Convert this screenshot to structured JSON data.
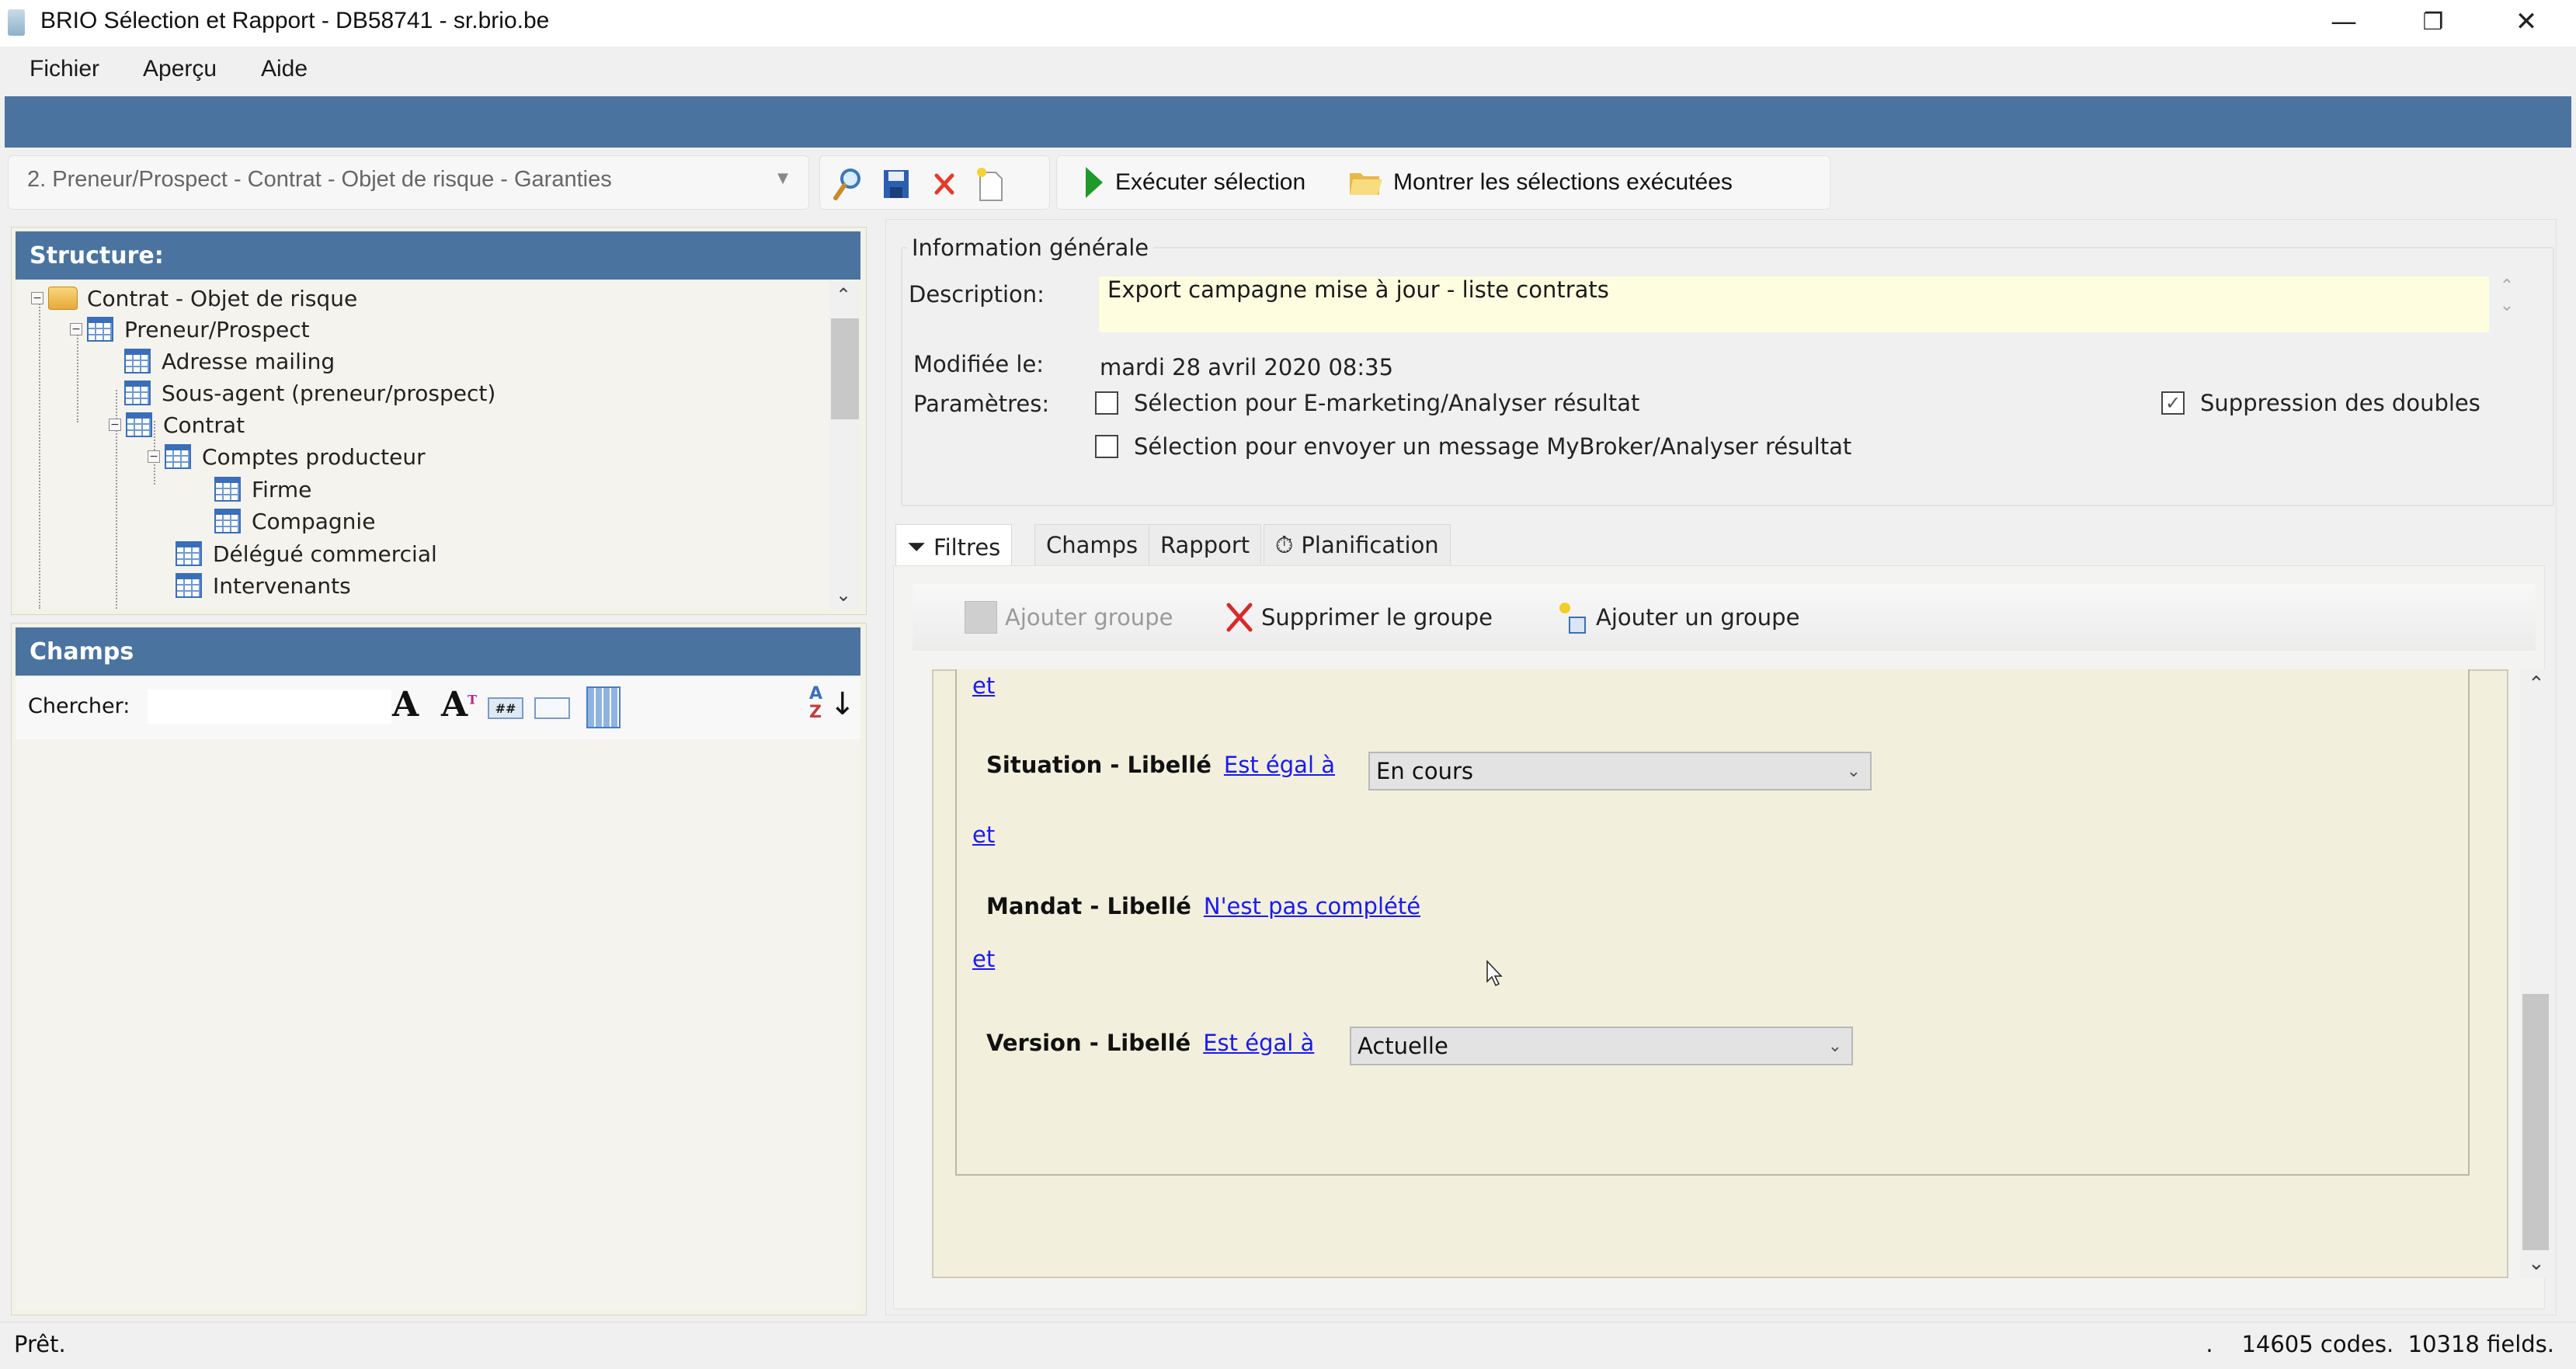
{
  "window": {
    "title": "BRIO Sélection et Rapport - DB58741 - sr.brio.be",
    "minimize": "—",
    "restore": "❐",
    "close": "✕"
  },
  "menu": [
    "Fichier",
    "Aperçu",
    "Aide"
  ],
  "toolbar": {
    "query_selected": "2. Preneur/Prospect - Contrat - Objet de risque - Garanties",
    "icons": [
      "search-icon",
      "save-icon",
      "delete-icon",
      "new-document-icon"
    ],
    "execute_label": "Exécuter sélection",
    "show_executed_label": "Montrer les sélections exécutées"
  },
  "structure": {
    "title": "Structure:",
    "tree": [
      {
        "label": "Contrat - Objet de risque",
        "level": 0,
        "icon": "folder",
        "expanded": true
      },
      {
        "label": "Preneur/Prospect",
        "level": 1,
        "icon": "table",
        "expanded": true
      },
      {
        "label": "Adresse mailing",
        "level": 2,
        "icon": "table"
      },
      {
        "label": "Sous-agent (preneur/prospect)",
        "level": 2,
        "icon": "table"
      },
      {
        "label": "Contrat",
        "level": 2,
        "icon": "table",
        "expanded": true
      },
      {
        "label": "Comptes producteur",
        "level": 3,
        "icon": "table",
        "expanded": true
      },
      {
        "label": "Firme",
        "level": 4,
        "icon": "table"
      },
      {
        "label": "Compagnie",
        "level": 4,
        "icon": "table"
      },
      {
        "label": "Délégué commercial",
        "level": 3,
        "icon": "table"
      },
      {
        "label": "Intervenants",
        "level": 3,
        "icon": "table"
      }
    ]
  },
  "champs": {
    "title": "Champs",
    "search_label": "Chercher:",
    "search_value": "",
    "tools": [
      "font-icon",
      "font-superscript-icon",
      "number-field-icon",
      "text-field-icon",
      "calculator-icon",
      "sort-az-icon"
    ]
  },
  "info": {
    "legend": "Information générale",
    "description_label": "Description:",
    "description": "Export campagne mise à jour - liste contrats",
    "modified_label": "Modifiée le:",
    "modified": "mardi 28 avril 2020 08:35",
    "params_label": "Paramètres:",
    "params": [
      {
        "label": "Sélection pour E-marketing/Analyser résultat",
        "checked": false
      },
      {
        "label": "Sélection pour envoyer un message MyBroker/Analyser résultat",
        "checked": false
      }
    ],
    "dedupe": {
      "label": "Suppression des doubles",
      "checked": true
    }
  },
  "tabs": [
    {
      "label": "Filtres",
      "icon": "filter-icon",
      "active": true
    },
    {
      "label": "Champs",
      "active": false
    },
    {
      "label": "Rapport",
      "active": false
    },
    {
      "label": "Planification",
      "icon": "stopwatch-icon",
      "active": false
    }
  ],
  "filter_toolbar": {
    "add_group": "Ajouter groupe",
    "delete_group": "Supprimer le groupe",
    "add_a_group": "Ajouter un groupe"
  },
  "filters": {
    "connector": "et",
    "conditions": [
      {
        "field": "Situation - Libellé",
        "operator": "Est égal à",
        "value": "En cours"
      },
      {
        "field": "Mandat - Libellé",
        "operator": "N'est pas complété",
        "value": null
      },
      {
        "field": "Version - Libellé",
        "operator": "Est égal à",
        "value": "Actuelle"
      }
    ]
  },
  "status": {
    "text": "Prêt.",
    "right": ".    14605 codes.  10318 fields."
  }
}
